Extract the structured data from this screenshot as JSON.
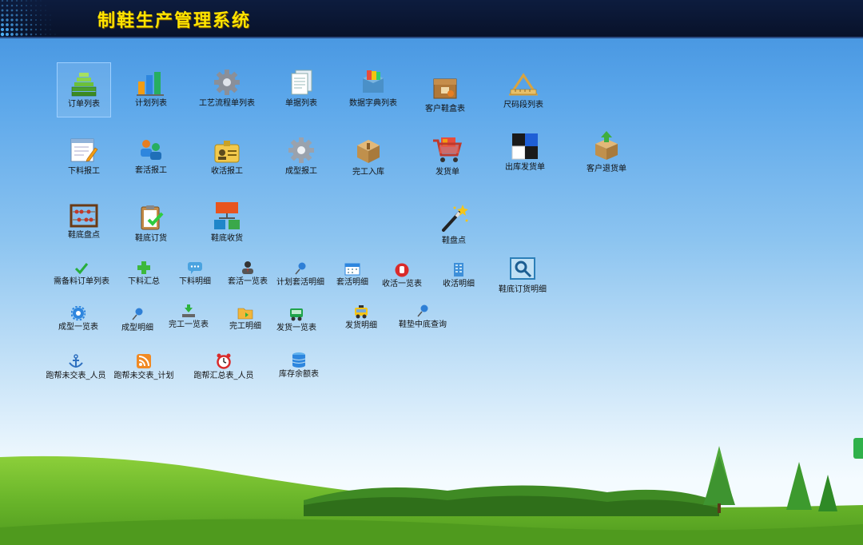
{
  "header": {
    "title": "制鞋生产管理系统"
  },
  "large_icons": [
    {
      "label": "订单列表",
      "icon": "stacked-blocks-icon"
    },
    {
      "label": "计划列表",
      "icon": "bar-chart-icon"
    },
    {
      "label": "工艺流程单列表",
      "icon": "gear-icon"
    },
    {
      "label": "单据列表",
      "icon": "document-stack-icon"
    },
    {
      "label": "数据字典列表",
      "icon": "book-box-icon"
    },
    {
      "label": "客户鞋盒表",
      "icon": "parcel-box-icon"
    },
    {
      "label": "尺码段列表",
      "icon": "ruler-triangle-icon"
    },
    {
      "label": "下料报工",
      "icon": "notepad-pencil-icon"
    },
    {
      "label": "套活报工",
      "icon": "users-group-icon"
    },
    {
      "label": "收活报工",
      "icon": "id-card-icon"
    },
    {
      "label": "成型报工",
      "icon": "gear-icon"
    },
    {
      "label": "完工入库",
      "icon": "cardboard-box-icon"
    },
    {
      "label": "发货单",
      "icon": "shopping-cart-icon"
    },
    {
      "label": "出库发货单",
      "icon": "checker-squares-icon"
    },
    {
      "label": "客户退货单",
      "icon": "box-upload-icon"
    },
    {
      "label": "鞋底盘点",
      "icon": "abacus-icon"
    },
    {
      "label": "鞋底订货",
      "icon": "clipboard-check-icon"
    },
    {
      "label": "鞋底收货",
      "icon": "org-chart-icon"
    },
    {
      "label": "鞋盘点",
      "icon": "magic-wand-icon"
    },
    {
      "label": "鞋底订货明细",
      "icon": "magnifier-monitor-icon"
    }
  ],
  "small_icons": [
    {
      "label": "需备料订单列表",
      "icon": "check-icon"
    },
    {
      "label": "下料汇总",
      "icon": "plus-icon"
    },
    {
      "label": "下料明细",
      "icon": "chat-bubble-icon"
    },
    {
      "label": "套活一览表",
      "icon": "user-icon"
    },
    {
      "label": "计划套活明细",
      "icon": "pushpin-icon"
    },
    {
      "label": "套活明细",
      "icon": "calendar-icon"
    },
    {
      "label": "收活一览表",
      "icon": "stop-hand-icon"
    },
    {
      "label": "收活明细",
      "icon": "building-icon"
    },
    {
      "label": "成型一览表",
      "icon": "gear-icon"
    },
    {
      "label": "成型明细",
      "icon": "pushpin-icon"
    },
    {
      "label": "完工一览表",
      "icon": "download-tray-icon"
    },
    {
      "label": "完工明细",
      "icon": "folder-icon"
    },
    {
      "label": "发货一览表",
      "icon": "car-icon"
    },
    {
      "label": "发货明细",
      "icon": "taxi-icon"
    },
    {
      "label": "鞋垫中底查询",
      "icon": "pushpin-icon"
    },
    {
      "label": "跑帮未交表_人员",
      "icon": "anchor-icon"
    },
    {
      "label": "跑帮未交表_计划",
      "icon": "rss-icon"
    },
    {
      "label": "跑帮汇总表_人员",
      "icon": "alarm-clock-icon"
    },
    {
      "label": "库存余额表",
      "icon": "database-icon"
    }
  ],
  "colors": {
    "title": "#ffe400",
    "header_bg": "#0a1633",
    "sky_top": "#3f8fdd",
    "grass": "#6fbb2c"
  }
}
